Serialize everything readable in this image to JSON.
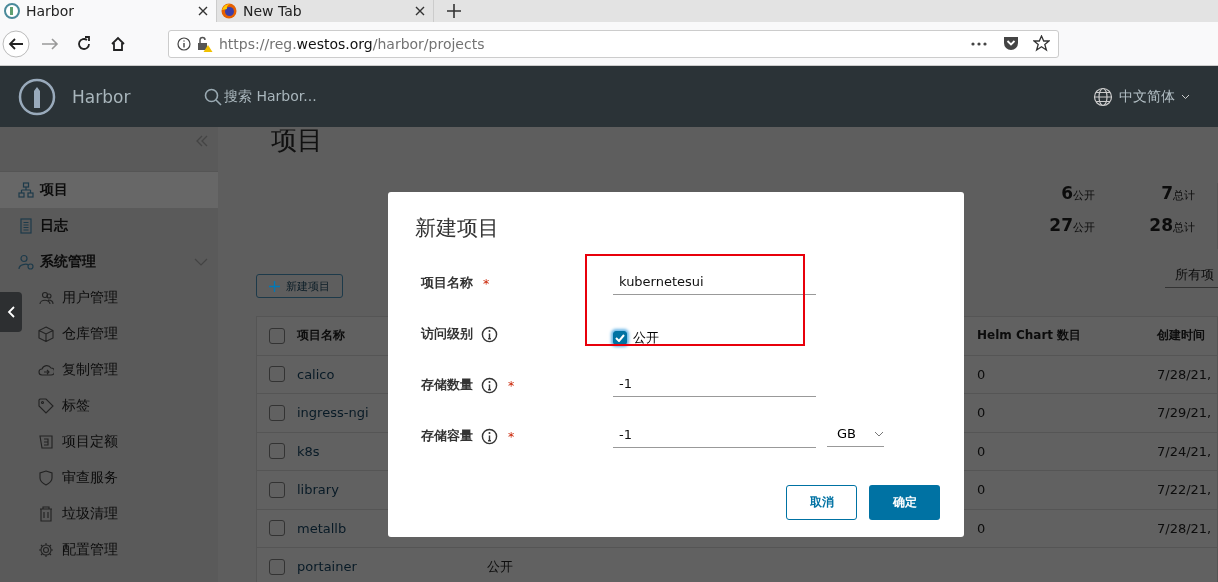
{
  "browser": {
    "tabs": [
      {
        "title": "Harbor",
        "selected": true
      },
      {
        "title": "New Tab",
        "selected": false
      }
    ],
    "url": [
      {
        "text": "https://reg.",
        "emphasis": false
      },
      {
        "text": "westos.org",
        "emphasis": true
      },
      {
        "text": "/harbor/projects",
        "emphasis": false
      }
    ]
  },
  "header": {
    "brand": "Harbor",
    "search": {
      "placeholder": "搜索 Harbor..."
    },
    "language": "中文简体"
  },
  "sidebar": {
    "items": [
      {
        "label": "项目",
        "selected": true
      },
      {
        "label": "日志",
        "selected": false
      },
      {
        "label": "系统管理",
        "selected": false,
        "expanded": true,
        "children": [
          {
            "label": "用户管理",
            "selected": false
          },
          {
            "label": "仓库管理",
            "selected": false
          },
          {
            "label": "复制管理",
            "selected": false
          },
          {
            "label": "标签",
            "selected": false
          },
          {
            "label": "项目定额",
            "selected": false
          },
          {
            "label": "审查服务",
            "selected": false
          },
          {
            "label": "垃圾清理",
            "selected": false
          },
          {
            "label": "配置管理",
            "selected": false
          }
        ]
      }
    ]
  },
  "main": {
    "title": "项目",
    "stats": [
      [
        {
          "number": "6",
          "label": "公开"
        },
        {
          "number": "7",
          "label": "总计"
        }
      ],
      [
        {
          "number": "27",
          "label": "公开"
        },
        {
          "number": "28",
          "label": "总计"
        }
      ]
    ],
    "new_button": "新建项目",
    "filter": "所有项"
  },
  "table": {
    "select_all_checked": false,
    "columns": [
      "项目名称",
      "Helm Chart 数目",
      "创建时间"
    ],
    "rows": [
      {
        "checked": false,
        "name": "calico",
        "helm_charts": "0",
        "created": "7/28/21,"
      },
      {
        "checked": false,
        "name": "ingress-ngi",
        "helm_charts": "0",
        "created": "7/29/21,"
      },
      {
        "checked": false,
        "name": "k8s",
        "helm_charts": "0",
        "created": "7/24/21,"
      },
      {
        "checked": false,
        "name": "library",
        "helm_charts": "0",
        "created": "7/22/21,"
      },
      {
        "checked": false,
        "name": "metallb",
        "helm_charts": "0",
        "created": "7/28/21,"
      },
      {
        "checked": false,
        "name": "portainer",
        "access": "公开"
      }
    ]
  },
  "dialog": {
    "title": "新建项目",
    "fields": [
      {
        "kind": "text",
        "label": "项目名称",
        "info": false,
        "required_mark": "*",
        "value": "kubernetesui"
      },
      {
        "kind": "checkbox",
        "label": "访问级别",
        "info": true,
        "checked": true,
        "option": "公开"
      },
      {
        "kind": "text",
        "label": "存储数量",
        "info": true,
        "required_mark": "*",
        "value": "-1"
      },
      {
        "kind": "text",
        "label": "存储容量",
        "info": true,
        "required_mark": "*",
        "value": "-1",
        "unit": "GB"
      }
    ],
    "buttons": [
      {
        "label": "取消",
        "kind": "secondary"
      },
      {
        "label": "确定",
        "kind": "primary"
      }
    ],
    "annotation": {
      "kind": "box"
    }
  }
}
